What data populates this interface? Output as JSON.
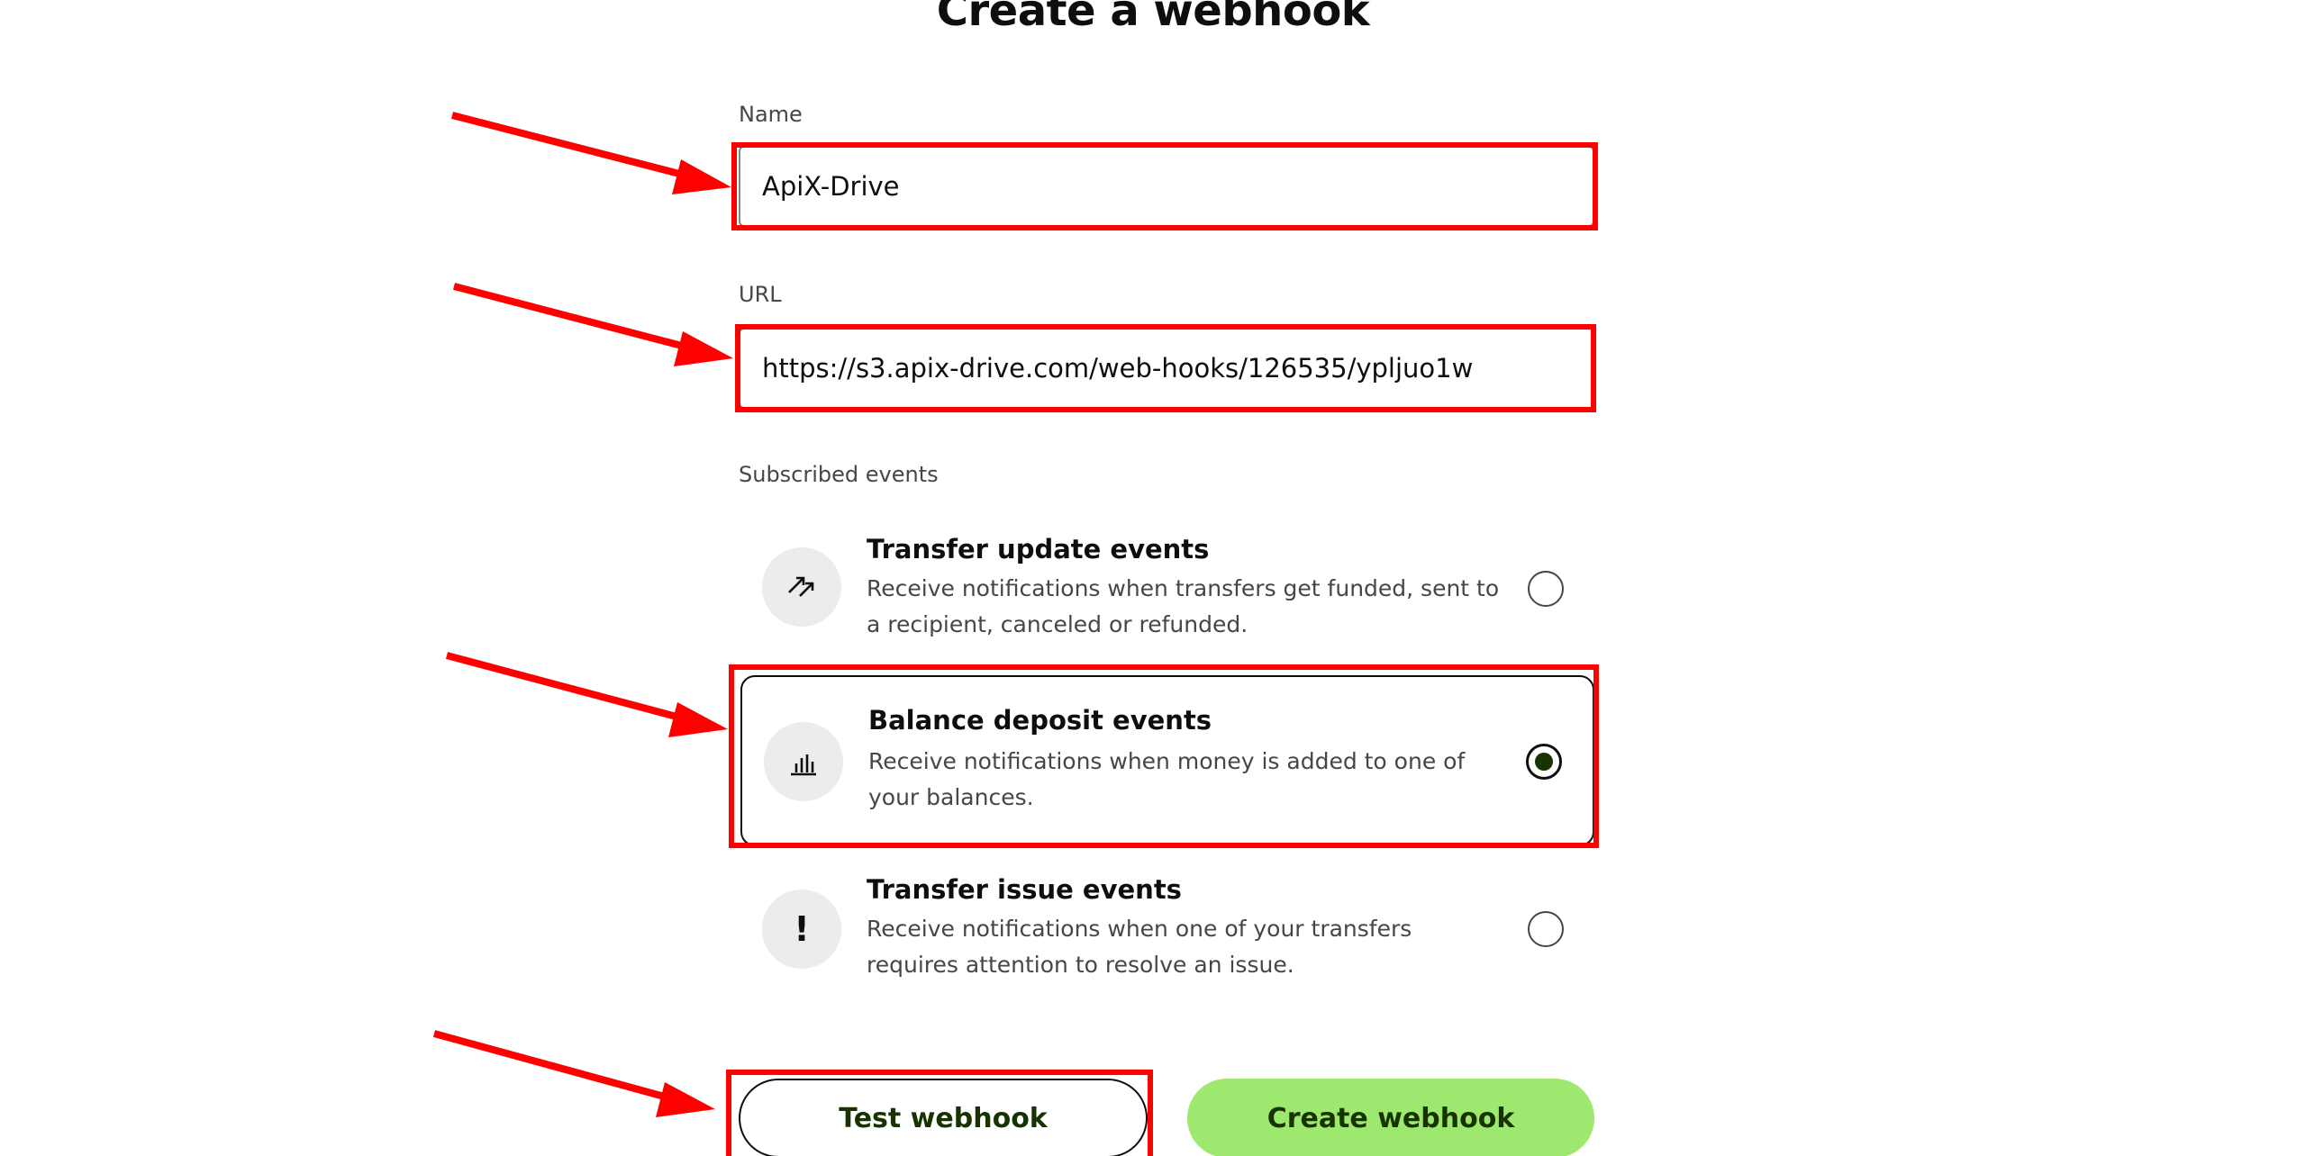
{
  "page": {
    "title": "Create a webhook"
  },
  "form": {
    "name": {
      "label": "Name",
      "value": "ApiX-Drive"
    },
    "url": {
      "label": "URL",
      "value": "https://s3.apix-drive.com/web-hooks/126535/ypljuo1w"
    },
    "subscribed_events": {
      "label": "Subscribed events",
      "options": [
        {
          "title": "Transfer update events",
          "description": "Receive notifications when transfers get funded, sent to a recipient, canceled or refunded.",
          "icon": "transfer-arrows-icon",
          "selected": false
        },
        {
          "title": "Balance deposit events",
          "description": "Receive notifications when money is added to one of your balances.",
          "icon": "bar-chart-icon",
          "selected": true
        },
        {
          "title": "Transfer issue events",
          "description": "Receive notifications when one of your transfers requires attention to resolve an issue.",
          "icon": "exclamation-icon",
          "selected": false
        }
      ]
    }
  },
  "actions": {
    "test_label": "Test webhook",
    "create_label": "Create webhook"
  },
  "colors": {
    "primary_button": "#9fe870",
    "button_text": "#163300",
    "annotation": "#ff0000"
  }
}
